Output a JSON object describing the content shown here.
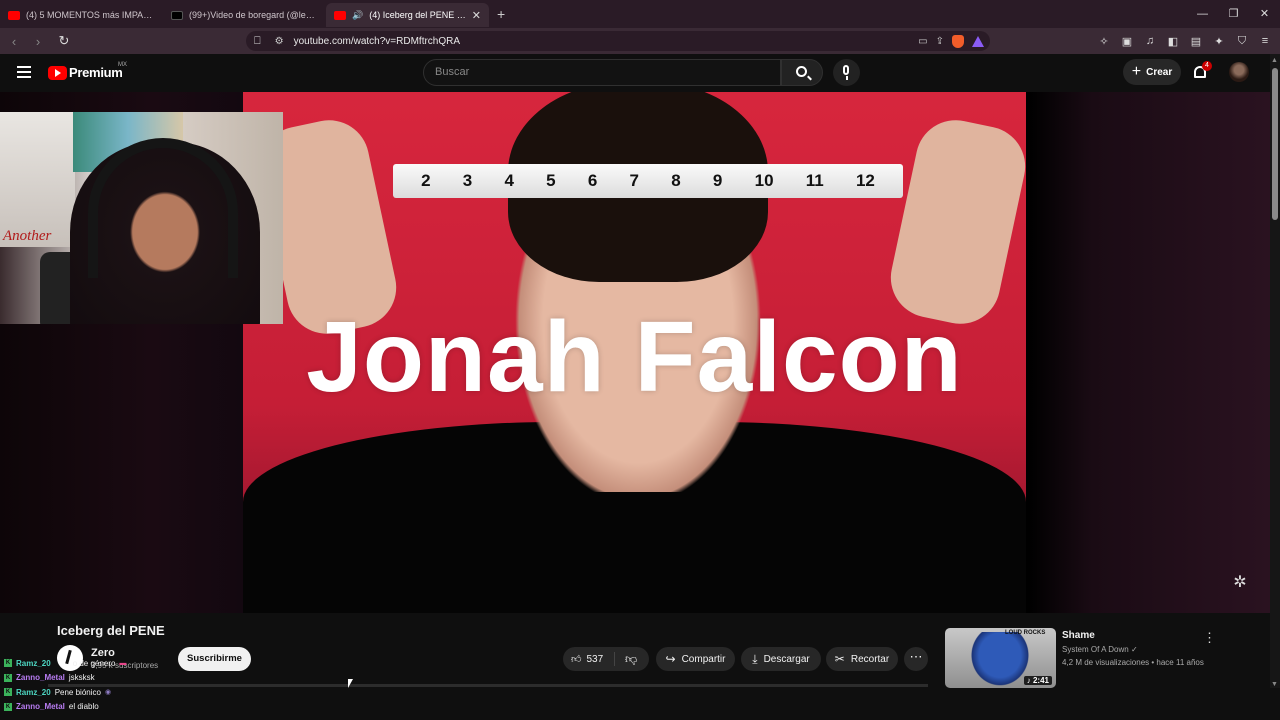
{
  "browser": {
    "tabs": [
      {
        "title": "(4) 5 MOMENTOS más IMPACTANTES",
        "favicon": "youtube-icon",
        "active": false
      },
      {
        "title": "(99+)Video de boregard (@leojanes",
        "favicon": "tiktok-icon",
        "active": false
      },
      {
        "title": "(4) Iceberg del PENE - YouTube",
        "favicon": "youtube-icon",
        "active": true
      }
    ],
    "url": "youtube.com/watch?v=RDMftrchQRA"
  },
  "youtube": {
    "brand": "Premium",
    "region": "MX",
    "search_placeholder": "Buscar",
    "create_label": "Crear",
    "notification_count": "4"
  },
  "video": {
    "overlay_title": "Jonah Falcon",
    "tape_numbers": [
      "2",
      "3",
      "4",
      "5",
      "6",
      "7",
      "8",
      "9",
      "10",
      "11",
      "12"
    ],
    "webcam_poster_text": "Another"
  },
  "details": {
    "title": "Iceberg del PENE",
    "channel": "Zero",
    "subscribers": "3,95 k suscriptores",
    "subscribe_label": "Suscribirme",
    "likes": "537",
    "share_label": "Compartir",
    "download_label": "Descargar",
    "clip_label": "Recortar"
  },
  "chat": [
    {
      "user": "Ramz_20",
      "message": "o de género"
    },
    {
      "user": "Zanno_Metal",
      "message": "jsksksk"
    },
    {
      "user": "Ramz_20",
      "message": "Pene biónico"
    },
    {
      "user": "Zanno_Metal",
      "message": "el diablo"
    }
  ],
  "recommendation": {
    "title": "Shame",
    "channel": "System Of A Down",
    "views": "4,2 M de visualizaciones",
    "age": "hace 11 años",
    "duration": "2:41",
    "thumb_text": "LOUD ROCKS"
  },
  "colors": {
    "brand_red": "#ff0000",
    "tab_bar": "#2a1b26",
    "chat_user_1": "#4dd6c2",
    "chat_user_2": "#b87cf2"
  }
}
